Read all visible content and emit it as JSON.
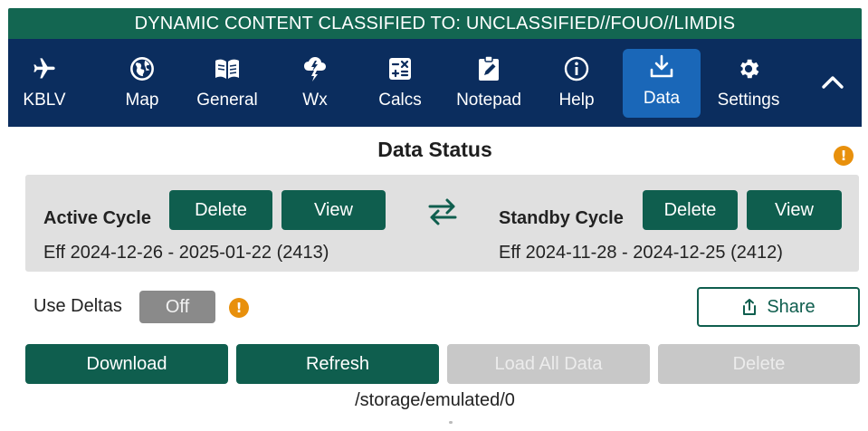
{
  "banner": {
    "text": "DYNAMIC CONTENT CLASSIFIED TO: UNCLASSIFIED//FOUO//LIMDIS"
  },
  "nav": {
    "items": [
      {
        "label": "KBLV",
        "icon": "airplane-icon"
      },
      {
        "label": "Map",
        "icon": "globe-icon"
      },
      {
        "label": "General",
        "icon": "book-icon"
      },
      {
        "label": "Wx",
        "icon": "weather-icon"
      },
      {
        "label": "Calcs",
        "icon": "calculator-icon"
      },
      {
        "label": "Notepad",
        "icon": "notepad-icon"
      },
      {
        "label": "Help",
        "icon": "info-icon"
      },
      {
        "label": "Data",
        "icon": "download-icon",
        "active": true
      },
      {
        "label": "Settings",
        "icon": "gear-icon"
      }
    ],
    "collapse_icon": "chevron-up-icon"
  },
  "page": {
    "title": "Data Status"
  },
  "active_cycle": {
    "label": "Active Cycle",
    "delete_label": "Delete",
    "view_label": "View",
    "eff": "Eff 2024-12-26 - 2025-01-22 (2413)"
  },
  "standby_cycle": {
    "label": "Standby Cycle",
    "delete_label": "Delete",
    "view_label": "View",
    "eff": "Eff 2024-11-28 - 2024-12-25 (2412)"
  },
  "deltas": {
    "label": "Use Deltas",
    "toggle_value": "Off"
  },
  "share": {
    "label": "Share"
  },
  "actions": {
    "download": "Download",
    "refresh": "Refresh",
    "load_all": "Load All Data",
    "delete": "Delete"
  },
  "storage": {
    "path": "/storage/emulated/0"
  },
  "colors": {
    "banner": "#136651",
    "nav": "#0b2d5e",
    "nav_active": "#1a67b8",
    "primary_button": "#0f5e4e",
    "disabled_button": "#c8c8c8",
    "info": "#e8900c"
  }
}
